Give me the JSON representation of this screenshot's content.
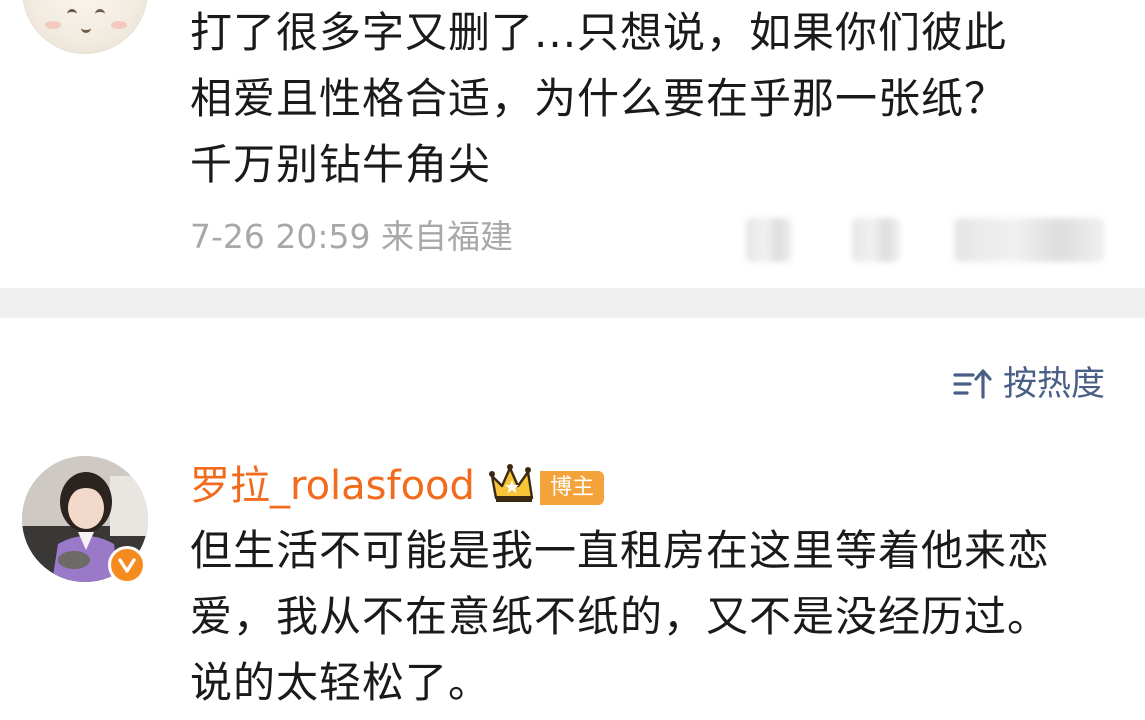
{
  "first_comment": {
    "lines": [
      "打了很多字又删了...只想说，如果你们彼此",
      "相爱且性格合适，为什么要在乎那一张纸？",
      "千万别钻牛角尖"
    ],
    "timestamp": "7-26 20:59",
    "location": "来自福建",
    "actions": [
      "share-blurred",
      "comment-blurred",
      "like-blurred"
    ]
  },
  "sort": {
    "label": "按热度",
    "icon": "sort-icon",
    "color": "#4a5f86"
  },
  "second_comment": {
    "username": "罗拉_rolasfood",
    "badge_label": "博主",
    "username_color": "#f26b1d",
    "lines": [
      "但生活不可能是我一直租房在这里等着他来恋",
      "爱，我从不在意纸不纸的，又不是没经历过。",
      "说的太轻松了。"
    ]
  },
  "colors": {
    "text": "#1a1a1a",
    "meta": "#a8a8a8",
    "divider": "#f0f0f0",
    "verified": "#f58b1f",
    "badge": "#f4a23a"
  }
}
